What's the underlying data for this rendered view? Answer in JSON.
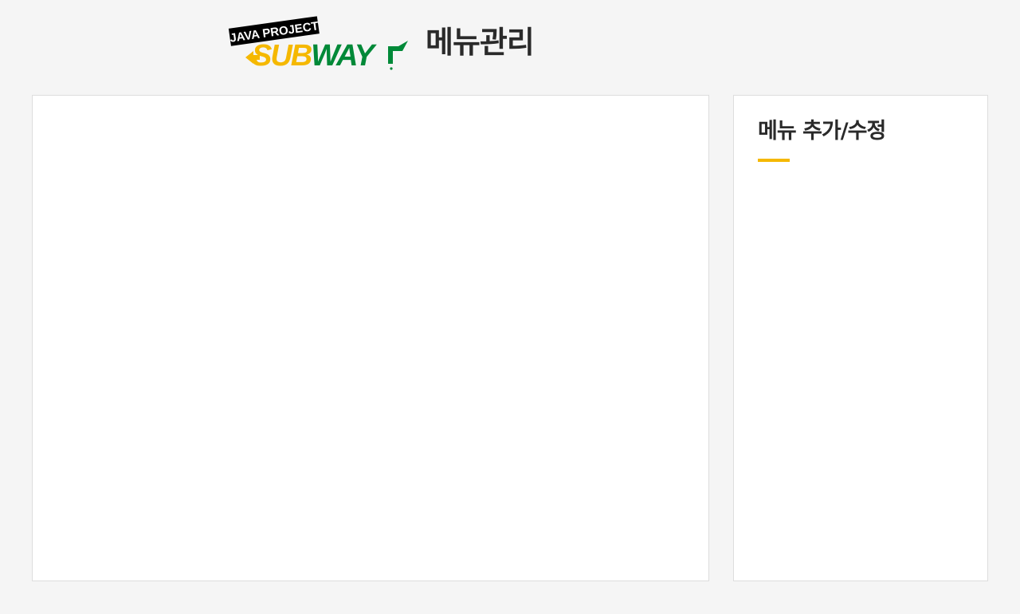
{
  "header": {
    "logo": {
      "banner_text": "JAVA PROJECT",
      "brand_text": "SUBWAY",
      "colors": {
        "banner_bg": "#000000",
        "banner_text": "#ffffff",
        "yellow": "#f5b800",
        "green": "#008938"
      }
    },
    "title": "메뉴관리"
  },
  "main_panel": {},
  "side_panel": {
    "heading": "메뉴 추가/수정",
    "accent_color": "#f5b800"
  }
}
